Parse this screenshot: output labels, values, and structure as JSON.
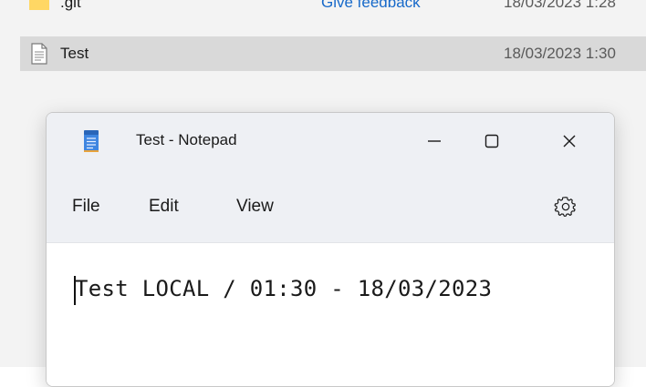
{
  "explorer": {
    "rows": [
      {
        "name": ".git",
        "link": "Give feedback",
        "date": "18/03/2023 1:28"
      },
      {
        "name": "Test",
        "date": "18/03/2023 1:30"
      }
    ]
  },
  "notepad": {
    "title": "Test - Notepad",
    "menu": {
      "file": "File",
      "edit": "Edit",
      "view": "View"
    },
    "content": "Test LOCAL / 01:30 - 18/03/2023"
  },
  "icons": {
    "folder": "folder-icon",
    "document": "document-icon",
    "app": "notepad-icon",
    "minimize": "minimize-icon",
    "maximize": "maximize-icon",
    "close": "close-icon",
    "settings": "gear-icon"
  }
}
